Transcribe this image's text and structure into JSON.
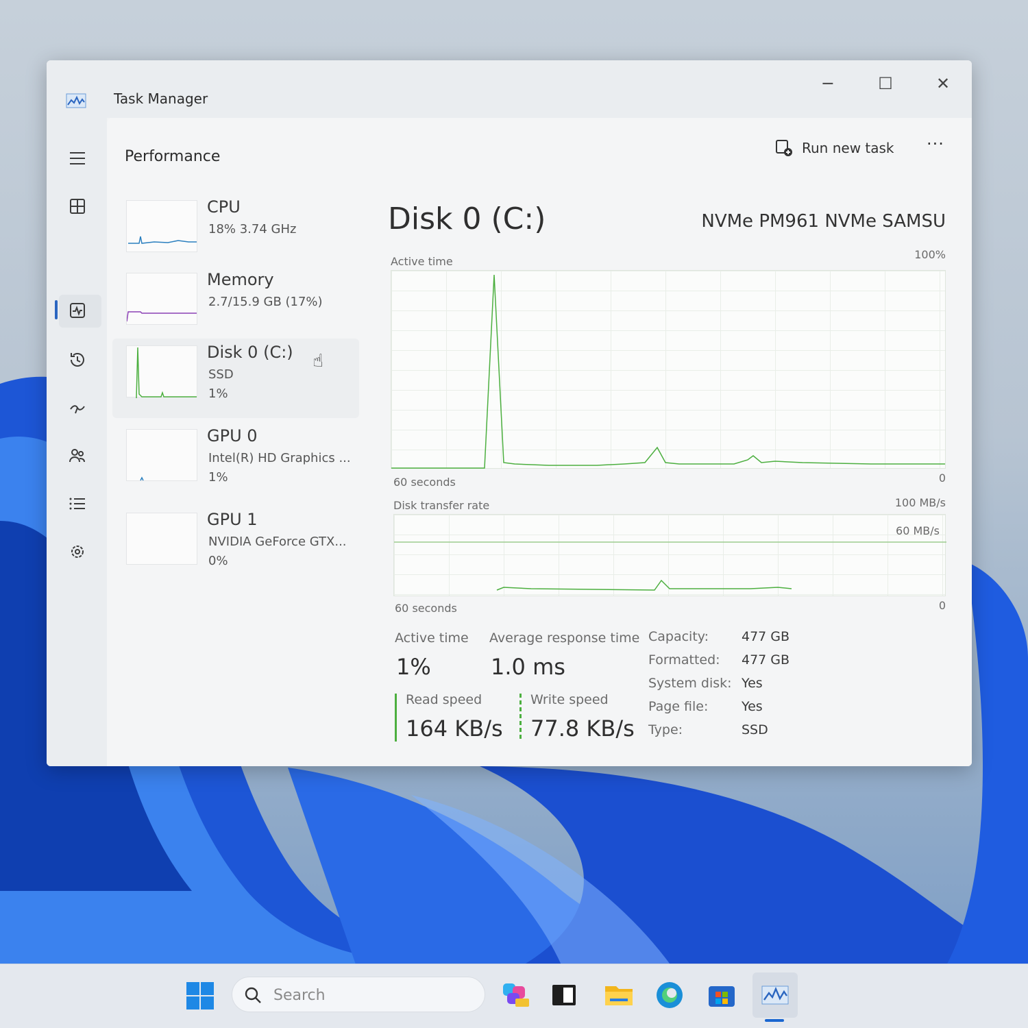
{
  "window": {
    "title": "Task Manager",
    "minimize_glyph": "─",
    "maximize_glyph": "☐",
    "close_glyph": "✕"
  },
  "header": {
    "page_title": "Performance",
    "run_new_task": "Run new task",
    "more": "···"
  },
  "nav": {
    "icons": [
      "hamburger-icon",
      "processes-icon",
      "performance-icon",
      "app-history-icon",
      "startup-apps-icon",
      "users-icon",
      "details-icon",
      "services-icon",
      "settings-icon"
    ],
    "active": "performance"
  },
  "devices": [
    {
      "name": "CPU",
      "sub": "18%  3.74 GHz",
      "val": ""
    },
    {
      "name": "Memory",
      "sub": "2.7/15.9 GB (17%)",
      "val": ""
    },
    {
      "name": "Disk 0 (C:)",
      "sub": "SSD",
      "val": "1%"
    },
    {
      "name": "GPU 0",
      "sub": "Intel(R) HD Graphics ...",
      "val": "1%"
    },
    {
      "name": "GPU 1",
      "sub": "NVIDIA GeForce GTX...",
      "val": "0%"
    }
  ],
  "detail": {
    "title": "Disk 0 (C:)",
    "model": "NVMe PM961 NVMe SAMSU",
    "active_graph": {
      "label": "Active time",
      "max": "100%",
      "min": "0",
      "time": "60 seconds"
    },
    "transfer_graph": {
      "label": "Disk transfer rate",
      "max": "100 MB/s",
      "mid": "60 MB/s",
      "min": "0",
      "time": "60 seconds"
    },
    "stats": {
      "active_time_label": "Active time",
      "active_time_value": "1%",
      "avg_response_label": "Average response time",
      "avg_response_value": "1.0 ms",
      "read_label": "Read speed",
      "read_value": "164 KB/s",
      "write_label": "Write speed",
      "write_value": "77.8 KB/s"
    },
    "props": [
      {
        "k": "Capacity:",
        "v": "477 GB"
      },
      {
        "k": "Formatted:",
        "v": "477 GB"
      },
      {
        "k": "System disk:",
        "v": "Yes"
      },
      {
        "k": "Page file:",
        "v": "Yes"
      },
      {
        "k": "Type:",
        "v": "SSD"
      }
    ]
  },
  "taskbar": {
    "search_placeholder": "Search",
    "pinned": [
      "copilot-icon",
      "terminal-icon",
      "file-explorer-icon",
      "edge-icon",
      "store-icon",
      "task-manager-icon"
    ]
  },
  "colors": {
    "accent": "#2b66c0",
    "graph_line": "#4caf3f",
    "memory_line": "#8b3fb5",
    "cpu_line": "#2a7fbf"
  }
}
